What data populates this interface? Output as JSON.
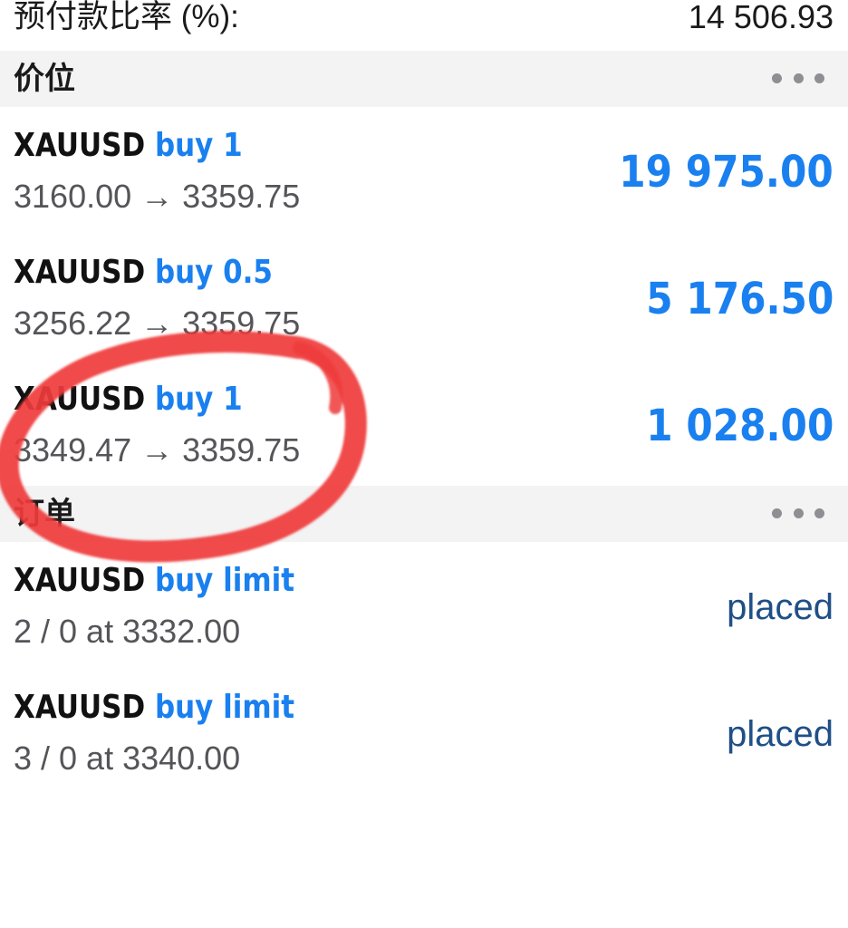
{
  "summary": {
    "label": "预付款比率 (%):",
    "value": "14 506.93"
  },
  "positions_section": {
    "title": "价位",
    "more_icon": "ellipsis-icon"
  },
  "positions": [
    {
      "symbol": "XAUUSD",
      "side": "buy 1",
      "detail": "3160.00 → 3359.75",
      "profit": "19 975.00"
    },
    {
      "symbol": "XAUUSD",
      "side": "buy 0.5",
      "detail": "3256.22 → 3359.75",
      "profit": "5 176.50"
    },
    {
      "symbol": "XAUUSD",
      "side": "buy 1",
      "detail": "3349.47 → 3359.75",
      "profit": "1 028.00"
    }
  ],
  "orders_section": {
    "title": "订单",
    "more_icon": "ellipsis-icon"
  },
  "orders": [
    {
      "symbol": "XAUUSD",
      "side": "buy limit",
      "detail": "2 / 0 at 3332.00",
      "status": "placed"
    },
    {
      "symbol": "XAUUSD",
      "side": "buy limit",
      "detail": "3 / 0 at 3340.00",
      "status": "placed"
    }
  ],
  "colors": {
    "accent": "#1a80ef",
    "status": "#1f4f86",
    "highlight_circle": "#ef3a3a",
    "header_bg": "#f3f3f4"
  }
}
